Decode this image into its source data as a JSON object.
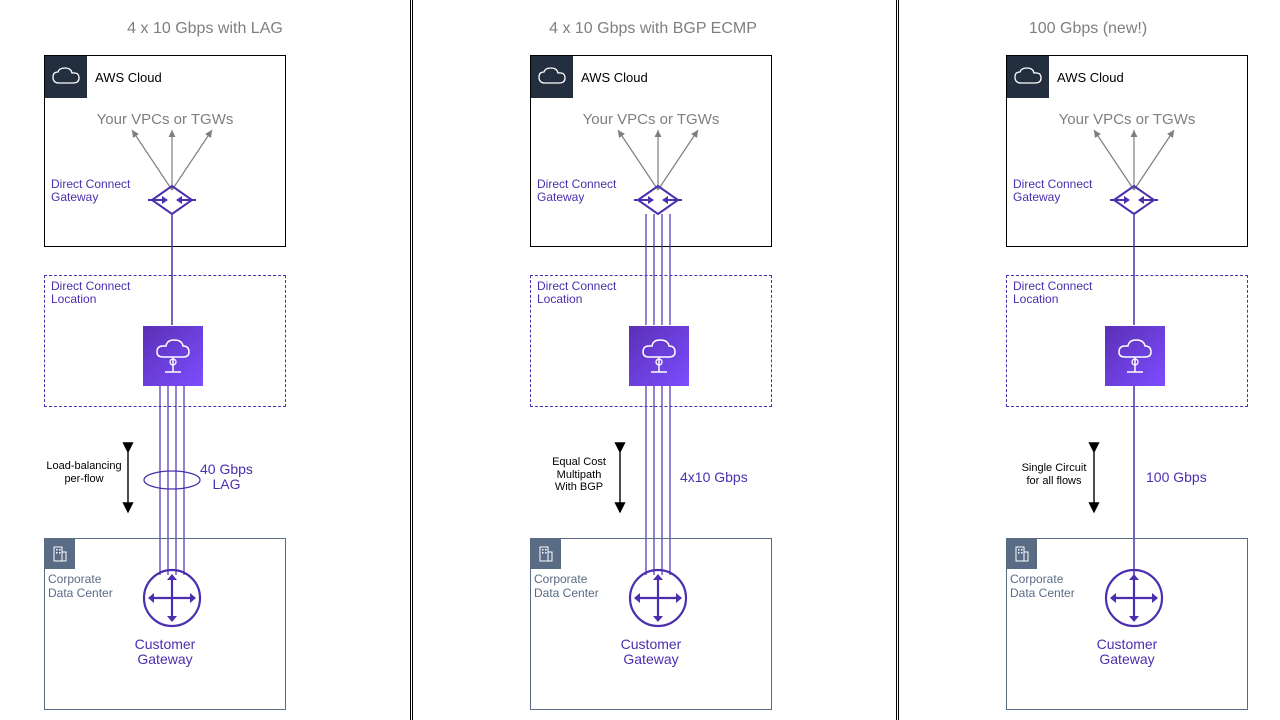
{
  "columns": [
    {
      "title": "4 x 10 Gbps with LAG",
      "aws_cloud": "AWS Cloud",
      "vpcs": "Your VPCs or TGWs",
      "dcg": "Direct Connect\nGateway",
      "dcl": "Direct Connect\nLocation",
      "left_note": "Load-balancing\nper-flow",
      "right_note": "40 Gbps\nLAG",
      "cdc": "Corporate\nData Center",
      "cgw": "Customer\nGateway",
      "link_count": 4,
      "lag_ellipse": true
    },
    {
      "title": "4 x 10 Gbps with BGP ECMP",
      "aws_cloud": "AWS Cloud",
      "vpcs": "Your VPCs or TGWs",
      "dcg": "Direct Connect\nGateway",
      "dcl": "Direct Connect\nLocation",
      "left_note": "Equal Cost\nMultipath\nWith BGP",
      "right_note": "4x10 Gbps",
      "cdc": "Corporate\nData Center",
      "cgw": "Customer\nGateway",
      "link_count": 4,
      "lag_ellipse": false
    },
    {
      "title": "100 Gbps (new!)",
      "aws_cloud": "AWS Cloud",
      "vpcs": "Your VPCs or TGWs",
      "dcg": "Direct Connect\nGateway",
      "dcl": "Direct Connect\nLocation",
      "left_note": "Single Circuit\nfor all flows",
      "right_note": "100 Gbps",
      "cdc": "Corporate\nData Center",
      "cgw": "Customer\nGateway",
      "link_count": 1,
      "lag_ellipse": false
    }
  ],
  "icons": {
    "cloud": "cloud-icon",
    "dcg": "direct-connect-gateway-icon",
    "dc": "direct-connect-icon",
    "building": "building-icon",
    "cgw": "customer-gateway-icon"
  },
  "colors": {
    "purple": "#4b2fae",
    "purple_fill": "#7c4dff",
    "grey": "#7f7f7f",
    "slate": "#5a6b86",
    "dark": "#232f3e"
  }
}
